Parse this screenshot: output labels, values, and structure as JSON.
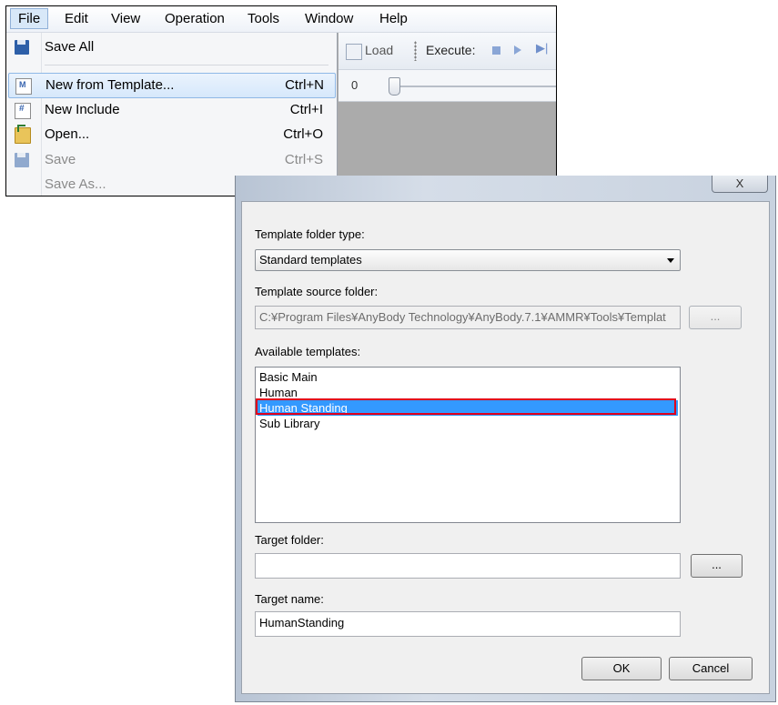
{
  "menubar": {
    "items": [
      "File",
      "Edit",
      "View",
      "Operation",
      "Tools",
      "Window",
      "Help"
    ]
  },
  "toolbar": {
    "load_label": "Load",
    "execute_label": "Execute:",
    "slider_value": "0"
  },
  "file_menu": {
    "items": [
      {
        "label": "Save All",
        "shortcut": "",
        "icon": "save-all-icon",
        "enabled": true
      },
      {
        "label": "New from Template...",
        "shortcut": "Ctrl+N",
        "icon": "new-template-icon",
        "enabled": true,
        "highlighted": true
      },
      {
        "label": "New Include",
        "shortcut": "Ctrl+I",
        "icon": "new-include-icon",
        "enabled": true
      },
      {
        "label": "Open...",
        "shortcut": "Ctrl+O",
        "icon": "open-folder-icon",
        "enabled": true
      },
      {
        "label": "Save",
        "shortcut": "Ctrl+S",
        "icon": "save-icon",
        "enabled": false
      },
      {
        "label": "Save As...",
        "shortcut": "",
        "icon": "",
        "enabled": false
      }
    ]
  },
  "dialog": {
    "close_glyph": "X",
    "template_folder_type_label": "Template folder type:",
    "template_folder_type_value": "Standard templates",
    "template_source_folder_label": "Template source folder:",
    "template_source_folder_value": "C:¥Program Files¥AnyBody Technology¥AnyBody.7.1¥AMMR¥Tools¥Templat",
    "browse_label": "...",
    "available_templates_label": "Available templates:",
    "templates": [
      "Basic Main",
      "Human",
      "Human Standing",
      "Sub Library"
    ],
    "selected_template": "Human Standing",
    "target_folder_label": "Target folder:",
    "target_folder_value": "",
    "target_name_label": "Target name:",
    "target_name_value": "HumanStanding",
    "ok_label": "OK",
    "cancel_label": "Cancel"
  },
  "colors": {
    "selection": "#3399ff",
    "highlight_frame": "#e0001b",
    "menu_hover": "#d6e8fb"
  }
}
